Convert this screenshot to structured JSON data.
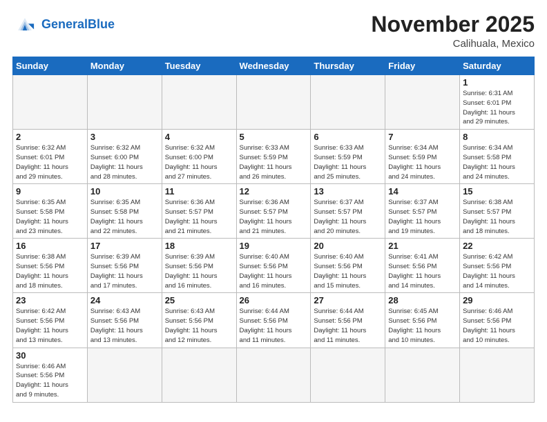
{
  "header": {
    "logo_general": "General",
    "logo_blue": "Blue",
    "month_title": "November 2025",
    "location": "Calihuala, Mexico"
  },
  "weekdays": [
    "Sunday",
    "Monday",
    "Tuesday",
    "Wednesday",
    "Thursday",
    "Friday",
    "Saturday"
  ],
  "weeks": [
    [
      {
        "day": "",
        "info": ""
      },
      {
        "day": "",
        "info": ""
      },
      {
        "day": "",
        "info": ""
      },
      {
        "day": "",
        "info": ""
      },
      {
        "day": "",
        "info": ""
      },
      {
        "day": "",
        "info": ""
      },
      {
        "day": "1",
        "info": "Sunrise: 6:31 AM\nSunset: 6:01 PM\nDaylight: 11 hours\nand 29 minutes."
      }
    ],
    [
      {
        "day": "2",
        "info": "Sunrise: 6:32 AM\nSunset: 6:01 PM\nDaylight: 11 hours\nand 29 minutes."
      },
      {
        "day": "3",
        "info": "Sunrise: 6:32 AM\nSunset: 6:00 PM\nDaylight: 11 hours\nand 28 minutes."
      },
      {
        "day": "4",
        "info": "Sunrise: 6:32 AM\nSunset: 6:00 PM\nDaylight: 11 hours\nand 27 minutes."
      },
      {
        "day": "5",
        "info": "Sunrise: 6:33 AM\nSunset: 5:59 PM\nDaylight: 11 hours\nand 26 minutes."
      },
      {
        "day": "6",
        "info": "Sunrise: 6:33 AM\nSunset: 5:59 PM\nDaylight: 11 hours\nand 25 minutes."
      },
      {
        "day": "7",
        "info": "Sunrise: 6:34 AM\nSunset: 5:59 PM\nDaylight: 11 hours\nand 24 minutes."
      },
      {
        "day": "8",
        "info": "Sunrise: 6:34 AM\nSunset: 5:58 PM\nDaylight: 11 hours\nand 24 minutes."
      }
    ],
    [
      {
        "day": "9",
        "info": "Sunrise: 6:35 AM\nSunset: 5:58 PM\nDaylight: 11 hours\nand 23 minutes."
      },
      {
        "day": "10",
        "info": "Sunrise: 6:35 AM\nSunset: 5:58 PM\nDaylight: 11 hours\nand 22 minutes."
      },
      {
        "day": "11",
        "info": "Sunrise: 6:36 AM\nSunset: 5:57 PM\nDaylight: 11 hours\nand 21 minutes."
      },
      {
        "day": "12",
        "info": "Sunrise: 6:36 AM\nSunset: 5:57 PM\nDaylight: 11 hours\nand 21 minutes."
      },
      {
        "day": "13",
        "info": "Sunrise: 6:37 AM\nSunset: 5:57 PM\nDaylight: 11 hours\nand 20 minutes."
      },
      {
        "day": "14",
        "info": "Sunrise: 6:37 AM\nSunset: 5:57 PM\nDaylight: 11 hours\nand 19 minutes."
      },
      {
        "day": "15",
        "info": "Sunrise: 6:38 AM\nSunset: 5:57 PM\nDaylight: 11 hours\nand 18 minutes."
      }
    ],
    [
      {
        "day": "16",
        "info": "Sunrise: 6:38 AM\nSunset: 5:56 PM\nDaylight: 11 hours\nand 18 minutes."
      },
      {
        "day": "17",
        "info": "Sunrise: 6:39 AM\nSunset: 5:56 PM\nDaylight: 11 hours\nand 17 minutes."
      },
      {
        "day": "18",
        "info": "Sunrise: 6:39 AM\nSunset: 5:56 PM\nDaylight: 11 hours\nand 16 minutes."
      },
      {
        "day": "19",
        "info": "Sunrise: 6:40 AM\nSunset: 5:56 PM\nDaylight: 11 hours\nand 16 minutes."
      },
      {
        "day": "20",
        "info": "Sunrise: 6:40 AM\nSunset: 5:56 PM\nDaylight: 11 hours\nand 15 minutes."
      },
      {
        "day": "21",
        "info": "Sunrise: 6:41 AM\nSunset: 5:56 PM\nDaylight: 11 hours\nand 14 minutes."
      },
      {
        "day": "22",
        "info": "Sunrise: 6:42 AM\nSunset: 5:56 PM\nDaylight: 11 hours\nand 14 minutes."
      }
    ],
    [
      {
        "day": "23",
        "info": "Sunrise: 6:42 AM\nSunset: 5:56 PM\nDaylight: 11 hours\nand 13 minutes."
      },
      {
        "day": "24",
        "info": "Sunrise: 6:43 AM\nSunset: 5:56 PM\nDaylight: 11 hours\nand 13 minutes."
      },
      {
        "day": "25",
        "info": "Sunrise: 6:43 AM\nSunset: 5:56 PM\nDaylight: 11 hours\nand 12 minutes."
      },
      {
        "day": "26",
        "info": "Sunrise: 6:44 AM\nSunset: 5:56 PM\nDaylight: 11 hours\nand 11 minutes."
      },
      {
        "day": "27",
        "info": "Sunrise: 6:44 AM\nSunset: 5:56 PM\nDaylight: 11 hours\nand 11 minutes."
      },
      {
        "day": "28",
        "info": "Sunrise: 6:45 AM\nSunset: 5:56 PM\nDaylight: 11 hours\nand 10 minutes."
      },
      {
        "day": "29",
        "info": "Sunrise: 6:46 AM\nSunset: 5:56 PM\nDaylight: 11 hours\nand 10 minutes."
      }
    ],
    [
      {
        "day": "30",
        "info": "Sunrise: 6:46 AM\nSunset: 5:56 PM\nDaylight: 11 hours\nand 9 minutes."
      },
      {
        "day": "",
        "info": ""
      },
      {
        "day": "",
        "info": ""
      },
      {
        "day": "",
        "info": ""
      },
      {
        "day": "",
        "info": ""
      },
      {
        "day": "",
        "info": ""
      },
      {
        "day": "",
        "info": ""
      }
    ]
  ]
}
